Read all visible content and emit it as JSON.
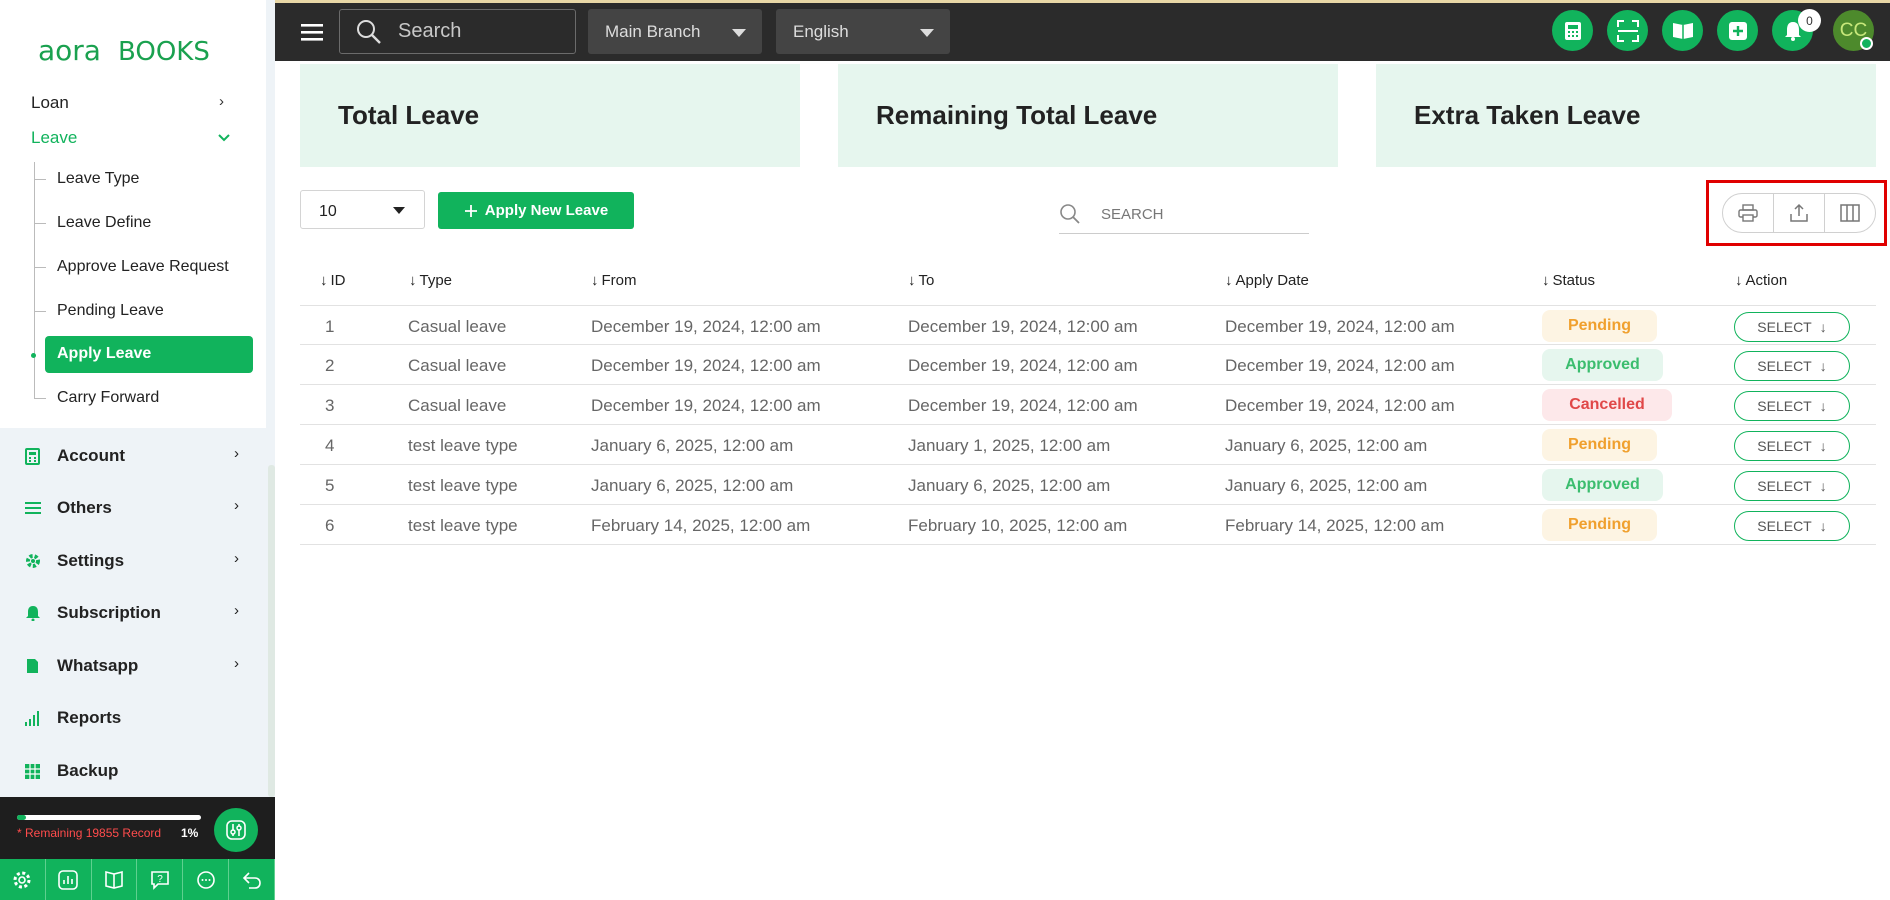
{
  "app": {
    "logo_text": "aora BOOKS"
  },
  "topbar": {
    "search_placeholder": "Search",
    "branch": "Main Branch",
    "language": "English",
    "notifications_count": "0",
    "avatar_initials": "CC"
  },
  "sidebar": {
    "loan": "Loan",
    "leave": "Leave",
    "leave_items": [
      "Leave Type",
      "Leave Define",
      "Approve Leave Request",
      "Pending Leave",
      "Apply Leave",
      "Carry Forward"
    ],
    "menus": [
      "Account",
      "Others",
      "Settings",
      "Subscription",
      "Whatsapp",
      "Reports",
      "Backup"
    ],
    "quota_text": "* Remaining 19855 Record",
    "quota_percent": "1%",
    "quota_fraction": 0.01
  },
  "cards": [
    "Total Leave",
    "Remaining Total Leave",
    "Extra Taken Leave"
  ],
  "controls": {
    "per_page": "10",
    "apply_button": "Apply New Leave",
    "search_placeholder": "SEARCH"
  },
  "table": {
    "headers": [
      "ID",
      "Type",
      "From",
      "To",
      "Apply Date",
      "Status",
      "Action"
    ],
    "rows": [
      {
        "id": "1",
        "type": "Casual leave",
        "from": "December 19, 2024, 12:00 am",
        "to": "December 19, 2024, 12:00 am",
        "apply": "December 19, 2024, 12:00 am",
        "status": "Pending",
        "action": "SELECT"
      },
      {
        "id": "2",
        "type": "Casual leave",
        "from": "December 19, 2024, 12:00 am",
        "to": "December 19, 2024, 12:00 am",
        "apply": "December 19, 2024, 12:00 am",
        "status": "Approved",
        "action": "SELECT"
      },
      {
        "id": "3",
        "type": "Casual leave",
        "from": "December 19, 2024, 12:00 am",
        "to": "December 19, 2024, 12:00 am",
        "apply": "December 19, 2024, 12:00 am",
        "status": "Cancelled",
        "action": "SELECT"
      },
      {
        "id": "4",
        "type": "test leave type",
        "from": "January 6, 2025, 12:00 am",
        "to": "January 1, 2025, 12:00 am",
        "apply": "January 6, 2025, 12:00 am",
        "status": "Pending",
        "action": "SELECT"
      },
      {
        "id": "5",
        "type": "test leave type",
        "from": "January 6, 2025, 12:00 am",
        "to": "January 6, 2025, 12:00 am",
        "apply": "January 6, 2025, 12:00 am",
        "status": "Approved",
        "action": "SELECT"
      },
      {
        "id": "6",
        "type": "test leave type",
        "from": "February 14, 2025, 12:00 am",
        "to": "February 10, 2025, 12:00 am",
        "apply": "February 14, 2025, 12:00 am",
        "status": "Pending",
        "action": "SELECT"
      }
    ]
  },
  "colors": {
    "accent": "#11b35c",
    "topbar": "#2b2b2b",
    "card": "#e6f6ee",
    "highlight": "#e00000"
  }
}
